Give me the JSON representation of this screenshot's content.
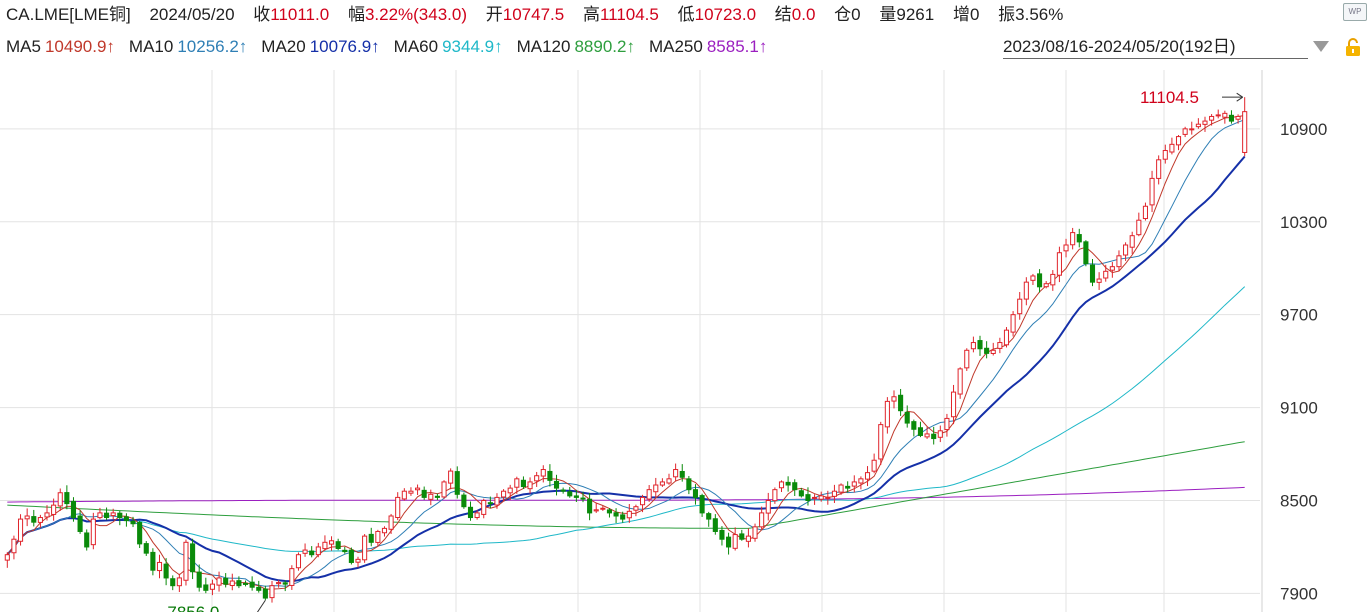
{
  "header": {
    "symbol": "CA.LME[LME铜]",
    "date": "2024/05/20",
    "close_label": "收",
    "close_value": "11011.0",
    "range_label": "幅",
    "range_value": "3.22%(343.0)",
    "open_label": "开",
    "open_value": "10747.5",
    "high_label": "高",
    "high_value": "11104.5",
    "low_label": "低",
    "low_value": "10723.0",
    "settle_label": "结",
    "settle_value": "0.0",
    "oi_label": "仓",
    "oi_value": "0",
    "volume_label": "量",
    "volume_value": "9261",
    "inc_label": "增",
    "inc_value": "0",
    "amp_label": "振",
    "amp_value": "3.56%"
  },
  "ma_legend": [
    {
      "label": "MA5",
      "value": "10490.9↑",
      "color": "#c0392b"
    },
    {
      "label": "MA10",
      "value": "10256.2↑",
      "color": "#2f7fb5"
    },
    {
      "label": "MA20",
      "value": "10076.9↑",
      "color": "#1530a8"
    },
    {
      "label": "MA60",
      "value": "9344.9↑",
      "color": "#1fb8c8"
    },
    {
      "label": "MA120",
      "value": "8890.2↑",
      "color": "#2e9e3e"
    },
    {
      "label": "MA250",
      "value": "8585.1↑",
      "color": "#9b1fc0"
    }
  ],
  "date_range": "2023/08/16-2024/05/20(192日)",
  "icons": {
    "dropdown": "triangle-down-icon",
    "lock": "lock-icon",
    "logo": "wp-logo-icon"
  },
  "wp_text": "WP",
  "colors": {
    "up": "#e0242b",
    "down": "#0a8a0a",
    "grid": "#e3e3e3"
  },
  "chart_data": {
    "type": "candlestick",
    "x_range": [
      "2023/08/16",
      "2024/05/20"
    ],
    "bars": 192,
    "ylim": [
      7780,
      11280
    ],
    "y_ticks": [
      7900,
      8500,
      9100,
      9700,
      10300,
      10900
    ],
    "max_annotation": {
      "label": "11104.5",
      "value": 11104.5,
      "color": "#d0021b"
    },
    "min_annotation": {
      "label": "7856.0",
      "value": 7856.0,
      "color": "#0a7a0a"
    },
    "last_bar": {
      "open": 10747.5,
      "high": 11104.5,
      "low": 10723.0,
      "close": 11011.0
    },
    "closes": [
      8150,
      8250,
      8380,
      8400,
      8360,
      8390,
      8420,
      8470,
      8550,
      8480,
      8390,
      8300,
      8200,
      8380,
      8420,
      8390,
      8420,
      8390,
      8370,
      8350,
      8220,
      8160,
      8050,
      8100,
      8000,
      7950,
      8000,
      8230,
      8040,
      7940,
      7920,
      7960,
      8000,
      7960,
      7980,
      7950,
      7960,
      7940,
      7920,
      7870,
      7950,
      7970,
      7960,
      8060,
      8150,
      8180,
      8150,
      8200,
      8230,
      8240,
      8190,
      8170,
      8100,
      8120,
      8270,
      8230,
      8300,
      8320,
      8400,
      8520,
      8560,
      8560,
      8580,
      8520,
      8540,
      8520,
      8620,
      8690,
      8540,
      8460,
      8390,
      8420,
      8500,
      8480,
      8520,
      8560,
      8580,
      8640,
      8590,
      8620,
      8660,
      8700,
      8630,
      8580,
      8560,
      8530,
      8520,
      8510,
      8420,
      8440,
      8450,
      8420,
      8400,
      8380,
      8430,
      8460,
      8520,
      8570,
      8600,
      8620,
      8640,
      8700,
      8650,
      8570,
      8520,
      8420,
      8380,
      8300,
      8250,
      8200,
      8280,
      8250,
      8270,
      8330,
      8420,
      8500,
      8570,
      8620,
      8600,
      8570,
      8530,
      8500,
      8520,
      8530,
      8520,
      8560,
      8600,
      8580,
      8620,
      8640,
      8680,
      8760,
      8990,
      9140,
      9170,
      9080,
      9000,
      8960,
      8920,
      8930,
      8900,
      8950,
      9030,
      9200,
      9350,
      9470,
      9520,
      9480,
      9450,
      9470,
      9520,
      9600,
      9700,
      9800,
      9910,
      9950,
      9880,
      9900,
      9960,
      10100,
      10150,
      10230,
      10170,
      10030,
      9910,
      9930,
      9980,
      10010,
      10080,
      10150,
      10210,
      10310,
      10400,
      10580,
      10700,
      10760,
      10800,
      10850,
      10900,
      10900,
      10930,
      10950,
      10980,
      10990,
      11000,
      10950,
      10980,
      11011
    ]
  }
}
